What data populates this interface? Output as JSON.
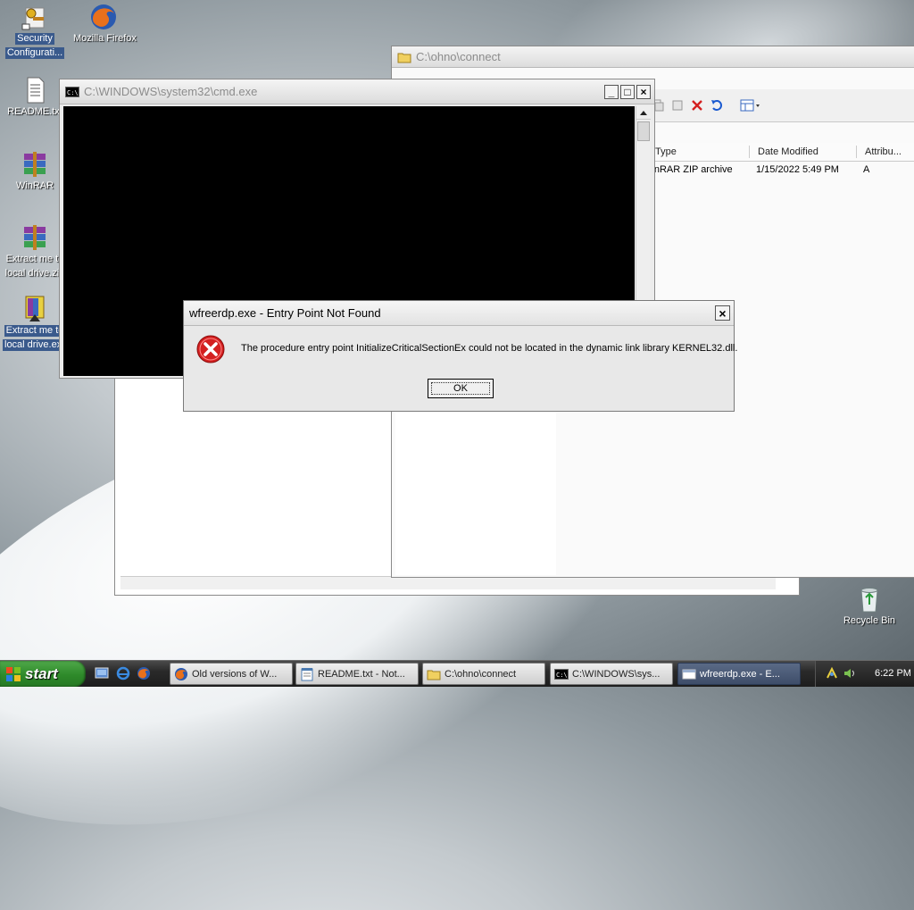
{
  "desktop": {
    "icons": [
      {
        "label1": "Security",
        "label2": "Configurati...",
        "icon": "security-config-icon"
      },
      {
        "label1": "Mozilla Firefox",
        "label2": "",
        "icon": "firefox-icon"
      },
      {
        "label1": "README.txt",
        "label2": "",
        "icon": "text-file-icon"
      },
      {
        "label1": "WinRAR",
        "label2": "",
        "icon": "winrar-icon"
      },
      {
        "label1": "Extract me to",
        "label2": "local drive.zip",
        "icon": "zip-archive-icon"
      },
      {
        "label1": "Extract me to",
        "label2": "local drive.exe",
        "icon": "sfx-archive-icon"
      },
      {
        "label1": "Recycle Bin",
        "label2": "",
        "icon": "recycle-bin-icon"
      }
    ]
  },
  "explorer": {
    "title": "C:\\ohno\\connect",
    "columns": {
      "type": "Type",
      "date": "Date Modified",
      "attr": "Attribu..."
    },
    "row": {
      "type": "WinRAR ZIP archive",
      "date": "1/15/2022 5:49 PM",
      "attr": "A"
    }
  },
  "cmd": {
    "title": "C:\\WINDOWS\\system32\\cmd.exe",
    "controls": {
      "minimize": "_",
      "maximize": "□",
      "close": "×"
    }
  },
  "dialog": {
    "title": "wfreerdp.exe - Entry Point Not Found",
    "message": "The procedure entry point InitializeCriticalSectionEx could not be located in the dynamic link library KERNEL32.dll.",
    "ok": "OK",
    "close": "×",
    "icon": "error-icon"
  },
  "taskbar": {
    "start": "start",
    "tasks": [
      {
        "label": "Old versions of W...",
        "icon": "firefox-icon",
        "active": false
      },
      {
        "label": "README.txt - Not...",
        "icon": "notepad-icon",
        "active": false
      },
      {
        "label": "C:\\ohno\\connect",
        "icon": "folder-icon",
        "active": false
      },
      {
        "label": "C:\\WINDOWS\\sys...",
        "icon": "cmd-icon",
        "active": false
      },
      {
        "label": "wfreerdp.exe - E...",
        "icon": "dialog-window-icon",
        "active": true
      }
    ],
    "clock": "6:22 PM"
  },
  "colors": {
    "accent": "#3a5a8c",
    "error": "#d42020",
    "start_green": "#2e8a2a"
  }
}
